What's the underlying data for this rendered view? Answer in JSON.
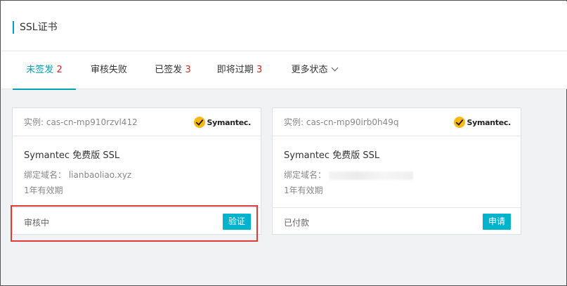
{
  "header": {
    "title": "SSL证书"
  },
  "tabs": [
    {
      "label": "未签发",
      "count": "2"
    },
    {
      "label": "审核失败",
      "count": ""
    },
    {
      "label": "已签发",
      "count": "3"
    },
    {
      "label": "即将过期",
      "count": "3"
    },
    {
      "label": "更多状态",
      "count": ""
    }
  ],
  "cards": [
    {
      "instance": "实例: cas-cn-mp910rzvl412",
      "brand": "Symantec.",
      "product": "Symantec 免费版 SSL",
      "domain": "绑定域名： lianbaoliao.xyz",
      "validity": "1年有效期",
      "status": "审核中",
      "action": "验证"
    },
    {
      "instance": "实例: cas-cn-mp90irb0h49q",
      "brand": "Symantec.",
      "product": "Symantec 免费版 SSL",
      "domain": "绑定域名：",
      "validity": "1年有效期",
      "status": "已付款",
      "action": "申请"
    }
  ],
  "colors": {
    "accent": "#00a2b3",
    "button": "#00b3cc",
    "count": "#e02020",
    "highlight": "#e03a3a"
  },
  "icons": {
    "brand_logo": "symantec-checkmark-icon",
    "more_status": "chevron-down-icon"
  }
}
